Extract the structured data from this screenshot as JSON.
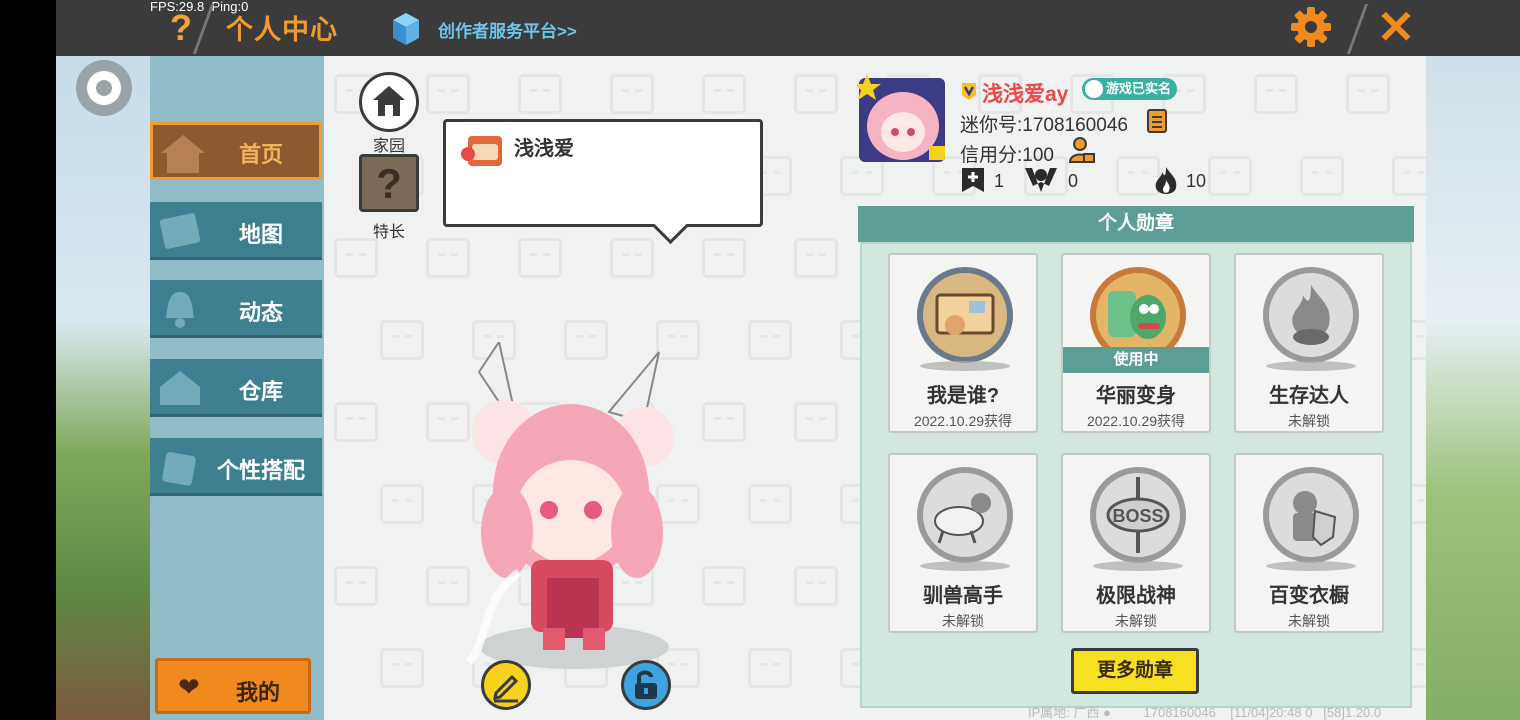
{
  "status": {
    "fps": "FPS:29.8",
    "ping": "Ping:0"
  },
  "header": {
    "title": "个人中心",
    "platform_link": "创作者服务平台>>"
  },
  "nav": {
    "items": [
      {
        "label": "首页",
        "active": true,
        "icon": "house-icon"
      },
      {
        "label": "地图",
        "active": false,
        "icon": "map-icon"
      },
      {
        "label": "动态",
        "active": false,
        "icon": "bell-icon"
      },
      {
        "label": "仓库",
        "active": false,
        "icon": "warehouse-icon"
      },
      {
        "label": "个性搭配",
        "active": false,
        "icon": "outfit-icon"
      }
    ],
    "mine_label": "我的"
  },
  "home": {
    "home_label": "家园",
    "skill_label": "特长",
    "bubble_name": "浅浅爱"
  },
  "profile": {
    "nickname": "浅浅爱ay",
    "realname_badge": "游戏已实名",
    "uid": "迷你号:1708160046",
    "credit": "信用分:100",
    "stats": {
      "posts": "1",
      "followers": "0",
      "fire": "10"
    }
  },
  "medals": {
    "title": "个人勋章",
    "items": [
      {
        "name": "我是谁?",
        "sub": "2022.10.29获得",
        "in_use": false,
        "unlocked": true
      },
      {
        "name": "华丽变身",
        "sub": "2022.10.29获得",
        "in_use": true,
        "in_use_label": "使用中",
        "unlocked": true
      },
      {
        "name": "生存达人",
        "sub": "未解锁",
        "in_use": false,
        "unlocked": false
      },
      {
        "name": "驯兽高手",
        "sub": "未解锁",
        "in_use": false,
        "unlocked": false
      },
      {
        "name": "极限战神",
        "sub": "未解锁",
        "in_use": false,
        "unlocked": false,
        "emblem_text": "BOSS"
      },
      {
        "name": "百变衣橱",
        "sub": "未解锁",
        "in_use": false,
        "unlocked": false
      }
    ],
    "more_label": "更多勋章"
  },
  "footer": {
    "ip_label": "IP属地: 广西",
    "uid": "1708160046",
    "time": "[11/04]20:48 0",
    "extra": "[58]1.20.0"
  },
  "colors": {
    "accent_orange": "#f39a2c",
    "teal": "#5c9e96",
    "nav_blue": "#3f7f92",
    "name_red": "#e84a4a"
  }
}
